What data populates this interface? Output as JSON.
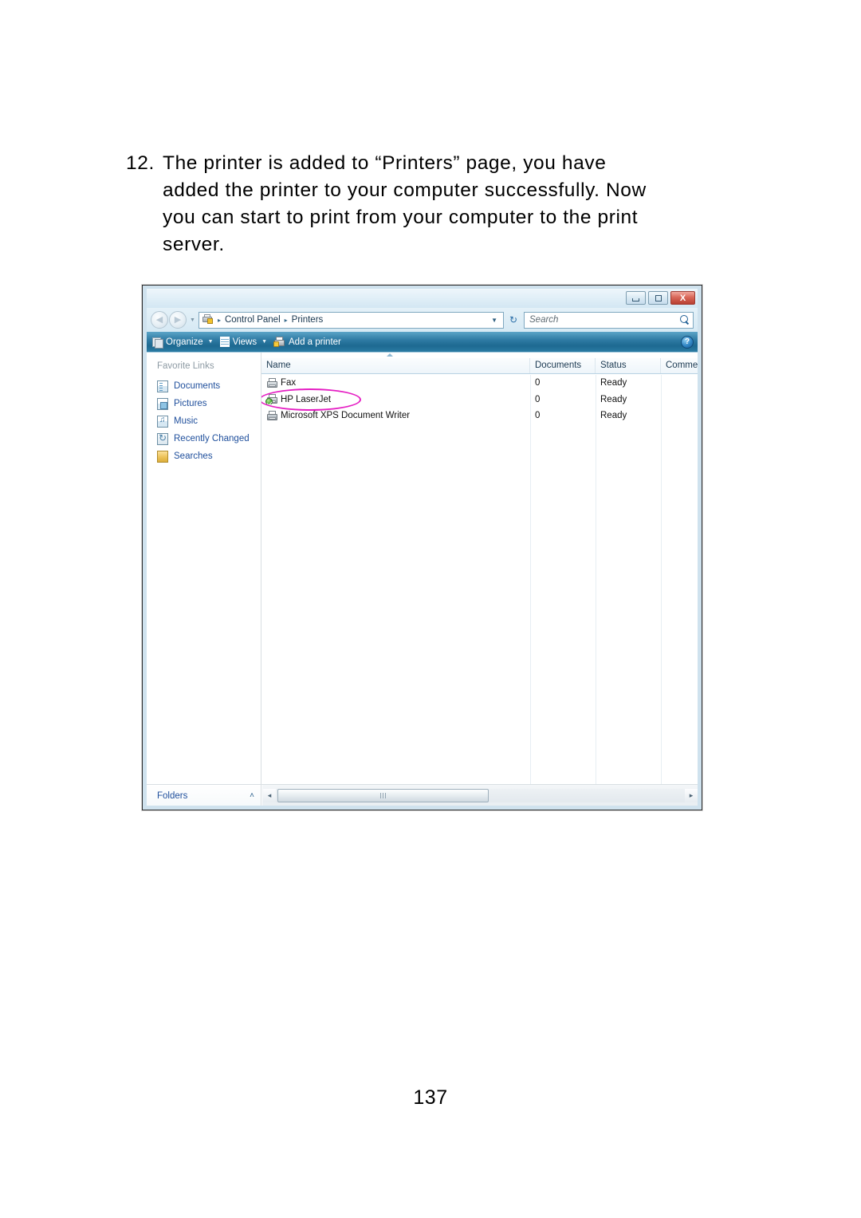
{
  "document": {
    "step_number": "12.",
    "instruction_lines": [
      "The printer is added to “Printers” page, you have",
      "added the printer to your computer successfully. Now",
      "you can start to print from your computer to the print",
      "server."
    ],
    "page_number": "137"
  },
  "window": {
    "controls": {
      "minimize": "Minimize",
      "maximize": "Maximize",
      "close": "X"
    },
    "navigation": {
      "back": "Back",
      "forward": "Forward",
      "recent_pages_caret": "▼"
    },
    "address": {
      "icon": "printers-folder-icon",
      "breadcrumbs": [
        "Control Panel",
        "Printers"
      ],
      "separator": "▸",
      "dropdown_caret": "▼",
      "refresh": "↻"
    },
    "search": {
      "placeholder": "Search",
      "icon": "search-icon"
    },
    "toolbar": {
      "organize": "Organize",
      "views": "Views",
      "add_printer": "Add a printer",
      "caret": "▼",
      "help": "?"
    },
    "sidebar": {
      "title": "Favorite Links",
      "items": [
        {
          "label": "Documents",
          "icon": "documents-icon"
        },
        {
          "label": "Pictures",
          "icon": "pictures-icon"
        },
        {
          "label": "Music",
          "icon": "music-icon"
        },
        {
          "label": "Recently Changed",
          "icon": "recently-changed-icon"
        },
        {
          "label": "Searches",
          "icon": "searches-folder-icon"
        }
      ]
    },
    "list": {
      "columns": [
        "Name",
        "Documents",
        "Status",
        "Comments"
      ],
      "column_comments_truncated": "Commen",
      "sort_indicator": "ascending",
      "rows": [
        {
          "name": "Fax",
          "documents": "0",
          "status": "Ready",
          "comments": "",
          "icon": "fax-printer-icon",
          "default": false
        },
        {
          "name": "HP LaserJet",
          "documents": "0",
          "status": "Ready",
          "comments": "",
          "icon": "printer-icon-default",
          "default": true
        },
        {
          "name": "Microsoft XPS Document Writer",
          "documents": "0",
          "status": "Ready",
          "comments": "",
          "icon": "xps-printer-icon",
          "default": false
        }
      ]
    },
    "bottom": {
      "folders": "Folders",
      "folders_caret": "˄",
      "scroll_left": "◂",
      "scroll_right": "▸"
    }
  },
  "annotation": {
    "shape": "ellipse",
    "color": "#e51ec3",
    "targets": "HP LaserJet"
  }
}
